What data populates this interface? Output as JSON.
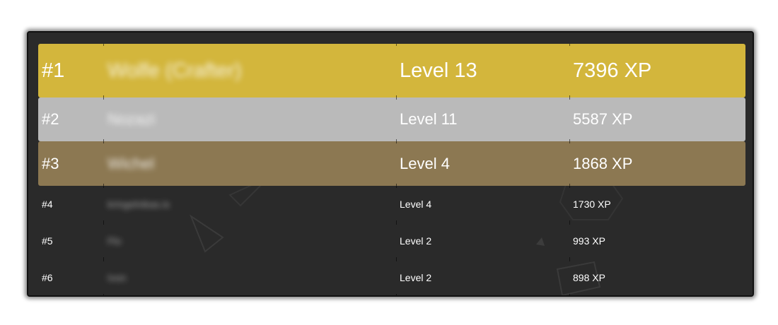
{
  "leaderboard": {
    "rows": [
      {
        "rank": "#1",
        "name": "Wolfe (Crafter)",
        "level": "Level 13",
        "xp": "7396 XP",
        "color": "#d3b63c"
      },
      {
        "rank": "#2",
        "name": "Nozazi",
        "level": "Level 11",
        "xp": "5587 XP",
        "color": "#bababa"
      },
      {
        "rank": "#3",
        "name": "Wichel",
        "level": "Level 4",
        "xp": "1868 XP",
        "color": "#8c7852"
      },
      {
        "rank": "#4",
        "name": "kringelnikas.is",
        "level": "Level 4",
        "xp": "1730 XP"
      },
      {
        "rank": "#5",
        "name": "Flo",
        "level": "Level 2",
        "xp": "993 XP"
      },
      {
        "rank": "#6",
        "name": "Ivon",
        "level": "Level 2",
        "xp": "898 XP"
      }
    ]
  },
  "theme": {
    "panel_background": "#2a2a2a",
    "gold": "#d3b63c",
    "silver": "#bababa",
    "bronze": "#8c7852"
  }
}
